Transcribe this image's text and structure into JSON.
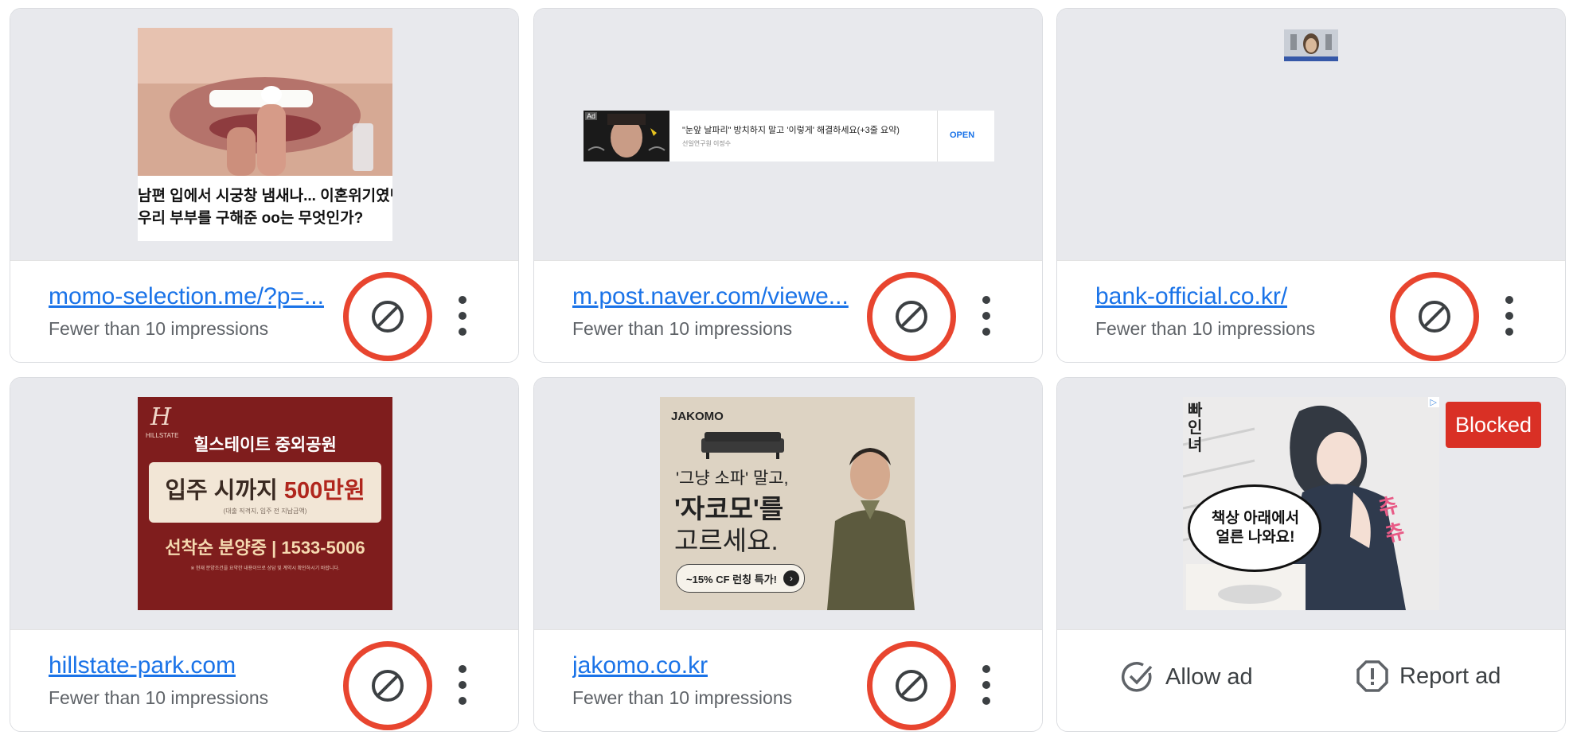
{
  "cards": [
    {
      "url": "momo-selection.me/?p=...",
      "impressions": "Fewer than 10 impressions",
      "ad": {
        "headline_line1": "남편 입에서 시궁창 냄새나... 이혼위기였던",
        "headline_line2": "우리 부부를 구해준 oo는 무엇인가?"
      }
    },
    {
      "url": "m.post.naver.com/viewe...",
      "impressions": "Fewer than 10 impressions",
      "ad": {
        "badge": "Ad",
        "headline": "\"눈앞 날파리\" 방치하지 말고 '이렇게' 해결하세요(+3줄 요약)",
        "source": "선일연구원 이정수",
        "cta": "OPEN"
      }
    },
    {
      "url": "bank-official.co.kr/",
      "impressions": "Fewer than 10 impressions"
    },
    {
      "url": "hillstate-park.com",
      "impressions": "Fewer than 10 impressions",
      "ad": {
        "brand": "HILLSTATE",
        "title": "힐스테이트 중외공원",
        "promo_prefix": "입주 시까지 ",
        "promo_amount": "500만원",
        "promo_note": "(대출 직격지, 입주 전 지납금액)",
        "sale_text": "선착순 분양중 | 1533-5006",
        "disclaimer": "※ 현재 분양조건을 요약한 내용이므로 상담 및 계약시 확인하시기 바랍니다."
      }
    },
    {
      "url": "jakomo.co.kr",
      "impressions": "Fewer than 10 impressions",
      "ad": {
        "brand": "JAKOMO",
        "line1": "'그냥 소파' 말고,",
        "line2": "'자코모'를",
        "line3": "고르세요.",
        "button": "~15% CF 런칭 특가!"
      }
    },
    {
      "ad": {
        "corner_badge": "▷",
        "title_vertical": "빠인녀",
        "bubble": "책상 아래에서 얼른 나와요!",
        "sfx": "츄츄"
      },
      "status": "Blocked",
      "allow_label": "Allow ad",
      "report_label": "Report ad"
    }
  ],
  "colors": {
    "link": "#1a73e8",
    "highlight_ring": "#e8452f",
    "blocked": "#d93025"
  },
  "icons": {
    "block": "block-icon",
    "more": "more-vert-icon",
    "allow": "check-circle-icon",
    "report": "report-icon"
  }
}
